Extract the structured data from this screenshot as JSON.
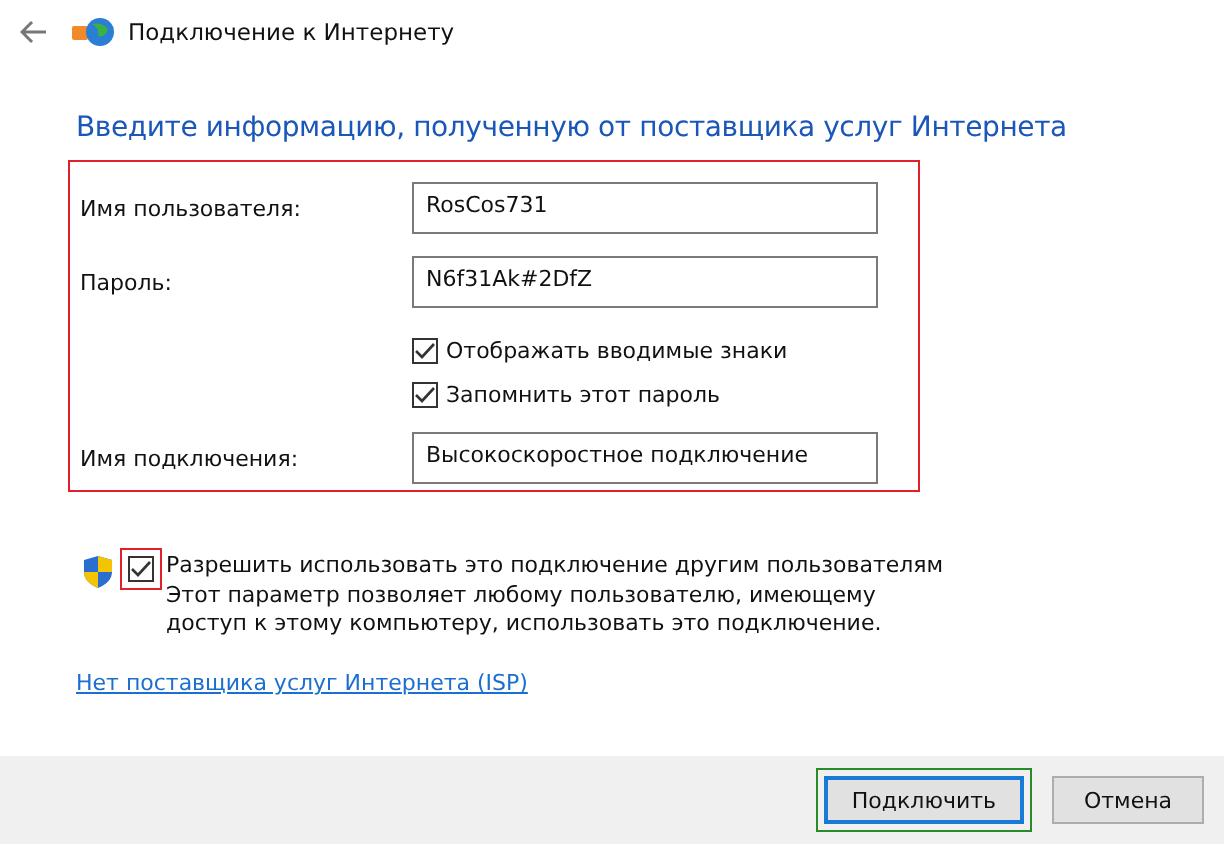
{
  "window": {
    "title": "Подключение к Интернету"
  },
  "heading": "Введите информацию, полученную от поставщика услуг Интернета",
  "fields": [
    {
      "label": "Имя пользователя:",
      "value": "RosCos731"
    },
    {
      "label": "Пароль:",
      "value": "N6f31Ak#2DfZ"
    }
  ],
  "password_options": [
    {
      "label": "Отображать вводимые знаки",
      "checked": true
    },
    {
      "label": "Запомнить этот пароль",
      "checked": true
    }
  ],
  "connection_name": {
    "label": "Имя подключения:",
    "value": "Высокоскоростное подключение"
  },
  "share": {
    "label": "Разрешить использовать это подключение другим пользователям",
    "checked": true,
    "description": "Этот параметр позволяет любому пользователю, имеющему доступ к этому компьютеру, использовать это подключение."
  },
  "link": "Нет поставщика услуг Интернета (ISP)",
  "buttons": [
    {
      "label": "Подключить",
      "kind": "default"
    },
    {
      "label": "Отмена",
      "kind": "normal"
    }
  ]
}
